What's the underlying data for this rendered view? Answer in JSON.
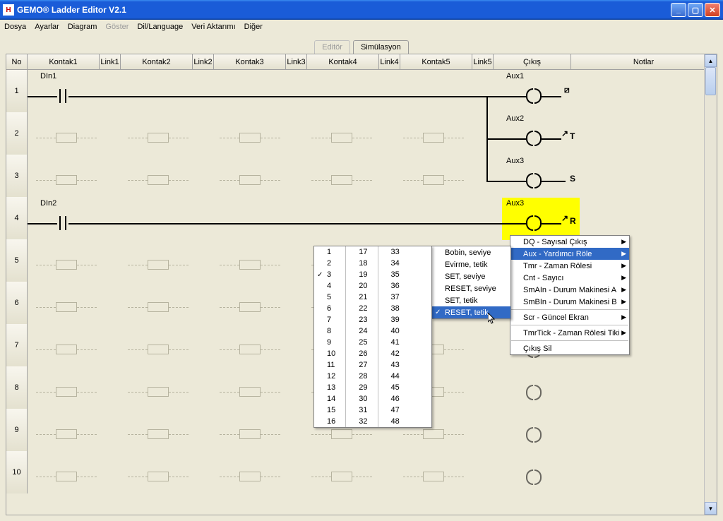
{
  "window": {
    "title": "GEMO® Ladder Editor V2.1"
  },
  "menu": {
    "file": "Dosya",
    "settings": "Ayarlar",
    "diagram": "Diagram",
    "show": "Göster",
    "lang": "Dil/Language",
    "transfer": "Veri Aktarımı",
    "other": "Diğer"
  },
  "tabs": {
    "editor": "Editör",
    "sim": "Simülasyon"
  },
  "headers": {
    "no": "No",
    "k1": "Kontak1",
    "l1": "Link1",
    "k2": "Kontak2",
    "l2": "Link2",
    "k3": "Kontak3",
    "l3": "Link3",
    "k4": "Kontak4",
    "l4": "Link4",
    "k5": "Kontak5",
    "l5": "Link5",
    "out": "Çıkış",
    "notes": "Notlar"
  },
  "rows": {
    "r1": {
      "num": "1",
      "in": "DIn1",
      "out": "Aux1"
    },
    "r2": {
      "num": "2",
      "out": "Aux2",
      "glyph": "T"
    },
    "r3": {
      "num": "3",
      "out": "Aux3",
      "glyph": "S"
    },
    "r4": {
      "num": "4",
      "in": "DIn2",
      "out": "Aux3",
      "glyph": "R"
    },
    "r5": "5",
    "r6": "6",
    "r7": "7",
    "r8": "8",
    "r9": "9",
    "r10": "10"
  },
  "context": {
    "main": [
      {
        "label": "DQ  - Sayısal Çıkış",
        "sub": true
      },
      {
        "label": "Aux - Yardımcı Röle",
        "sub": true,
        "sel": true
      },
      {
        "label": "Tmr - Zaman Rölesi",
        "sub": true
      },
      {
        "label": "Cnt - Sayıcı",
        "sub": true
      },
      {
        "label": "SmAIn - Durum Makinesi A",
        "sub": true
      },
      {
        "label": "SmBIn - Durum Makinesi B",
        "sub": true
      },
      {
        "sep": true
      },
      {
        "label": "Scr - Güncel Ekran",
        "sub": true
      },
      {
        "sep": true
      },
      {
        "label": "TmrTick - Zaman Rölesi Tiki",
        "sub": true
      },
      {
        "sep": true
      },
      {
        "label": "Çıkış Sil"
      }
    ],
    "types": [
      {
        "label": "Bobin, seviye"
      },
      {
        "label": "Evirme, tetik"
      },
      {
        "label": "SET, seviye"
      },
      {
        "label": "RESET, seviye"
      },
      {
        "label": "SET, tetik"
      },
      {
        "label": "RESET, tetik",
        "sel": true,
        "check": true
      }
    ],
    "nums_col1": [
      "1",
      "2",
      "3",
      "4",
      "5",
      "6",
      "7",
      "8",
      "9",
      "10",
      "11",
      "12",
      "13",
      "14",
      "15",
      "16"
    ],
    "nums_col2": [
      "17",
      "18",
      "19",
      "20",
      "21",
      "22",
      "23",
      "24",
      "25",
      "26",
      "27",
      "28",
      "29",
      "30",
      "31",
      "32"
    ],
    "nums_col3": [
      "33",
      "34",
      "35",
      "36",
      "37",
      "38",
      "39",
      "40",
      "41",
      "42",
      "43",
      "44",
      "45",
      "46",
      "47",
      "48"
    ],
    "num_checked": "3"
  }
}
